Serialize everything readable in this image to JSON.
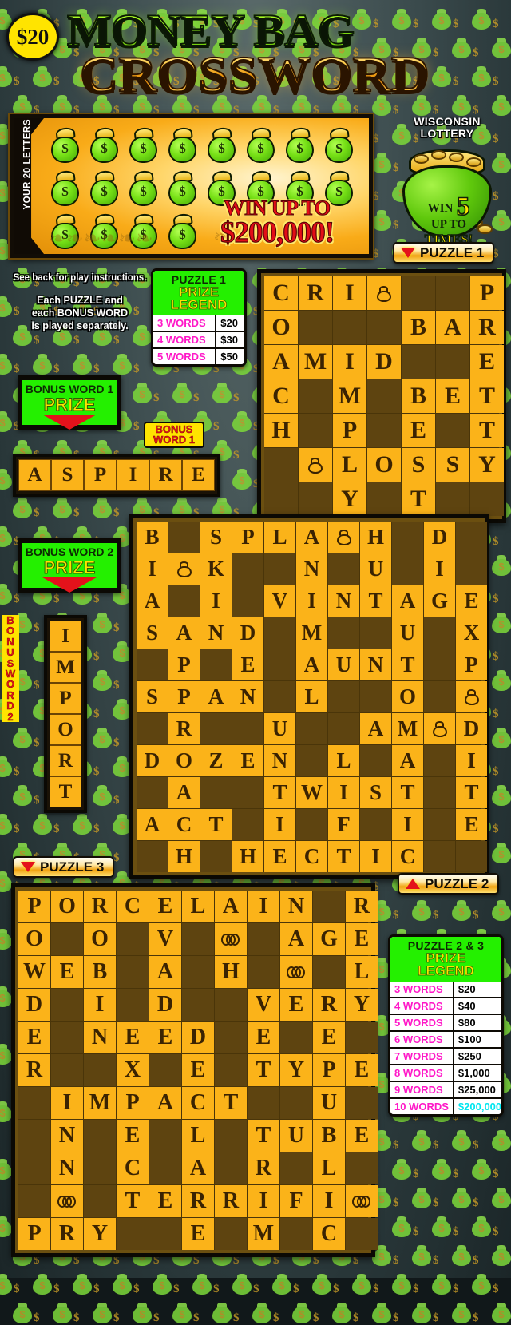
{
  "ticket": {
    "price": "$20",
    "title_line1": "MONEY BAG",
    "title_line2": "CROSSWORD"
  },
  "play_area": {
    "tab_label": "YOUR 20 LETTERS",
    "bag_icon": "money-bag-icon",
    "bag_symbol": "$",
    "bag_rows": [
      8,
      8,
      4
    ],
    "win_up_to_line1": "WIN UP TO",
    "win_up_to_line2": "$200,000!"
  },
  "lottery": {
    "name_line1": "WISCONSIN",
    "name_line2": "LOTTERY",
    "bag_text_a": "WIN",
    "bag_text_b": "UP TO",
    "bag_text_big": "5",
    "bag_text_c": "TIMES!"
  },
  "instructions": {
    "line1": "See back for play instructions.",
    "line2": "Each PUZZLE and",
    "line3": "each BONUS WORD",
    "line4": "is played separately."
  },
  "tabs": {
    "puzzle1": "PUZZLE 1",
    "puzzle2": "PUZZLE 2",
    "puzzle3": "PUZZLE 3"
  },
  "legend_p1": {
    "title": "PUZZLE 1",
    "prize": "PRIZE",
    "legend": "LEGEND",
    "rows": [
      {
        "words": "3 WORDS",
        "prize": "$20"
      },
      {
        "words": "4 WORDS",
        "prize": "$30"
      },
      {
        "words": "5 WORDS",
        "prize": "$50"
      }
    ]
  },
  "legend_p23": {
    "title": "PUZZLE 2 & 3",
    "prize": "PRIZE",
    "legend": "LEGEND",
    "rows": [
      {
        "words": "3 WORDS",
        "prize": "$20"
      },
      {
        "words": "4 WORDS",
        "prize": "$40"
      },
      {
        "words": "5 WORDS",
        "prize": "$80"
      },
      {
        "words": "6 WORDS",
        "prize": "$100"
      },
      {
        "words": "7 WORDS",
        "prize": "$250"
      },
      {
        "words": "8 WORDS",
        "prize": "$1,000"
      },
      {
        "words": "9 WORDS",
        "prize": "$25,000"
      },
      {
        "words": "10 WORDS",
        "prize": "$200,000"
      }
    ],
    "jackpot_color": "#00e6f0"
  },
  "bonus1": {
    "box_title": "BONUS WORD 1",
    "box_prize": "PRIZE",
    "flag_line1": "BONUS",
    "flag_line2": "WORD 1",
    "word": [
      "A",
      "S",
      "P",
      "I",
      "R",
      "E"
    ]
  },
  "bonus2": {
    "box_title": "BONUS WORD 2",
    "box_prize": "PRIZE",
    "flag_text": "BONUS WORD 2",
    "word": [
      "I",
      "M",
      "P",
      "O",
      "R",
      "T"
    ]
  },
  "puzzle1": {
    "cols": 7,
    "rows": 7,
    "cells": [
      [
        "C",
        "R",
        "I",
        "BAG",
        "",
        "",
        "P"
      ],
      [
        "O",
        "",
        "",
        "",
        "B",
        "A",
        "R"
      ],
      [
        "A",
        "M",
        "I",
        "D",
        "",
        "",
        "E"
      ],
      [
        "C",
        "",
        "M",
        "",
        "B",
        "E",
        "T"
      ],
      [
        "H",
        "",
        "P",
        "",
        "E",
        "",
        "T"
      ],
      [
        "",
        "BAG",
        "L",
        "O",
        "S",
        "S",
        "Y"
      ],
      [
        "",
        "",
        "Y",
        "",
        "T",
        "",
        ""
      ]
    ]
  },
  "puzzle2": {
    "cols": 11,
    "rows": 11,
    "cells": [
      [
        "B",
        "",
        "S",
        "P",
        "L",
        "A",
        "BAG",
        "H",
        "",
        "D",
        ""
      ],
      [
        "I",
        "BAG",
        "K",
        "",
        "",
        "N",
        "",
        "U",
        "",
        "I",
        ""
      ],
      [
        "A",
        "",
        "I",
        "",
        "V",
        "I",
        "N",
        "T",
        "A",
        "G",
        "E"
      ],
      [
        "S",
        "A",
        "N",
        "D",
        "",
        "M",
        "",
        "",
        "U",
        "",
        "X"
      ],
      [
        "",
        "P",
        "",
        "E",
        "",
        "A",
        "U",
        "N",
        "T",
        "",
        "P"
      ],
      [
        "S",
        "P",
        "A",
        "N",
        "",
        "L",
        "",
        "",
        "O",
        "",
        "BAG"
      ],
      [
        "",
        "R",
        "",
        "",
        "U",
        "",
        "",
        "A",
        "M",
        "BAG",
        "D"
      ],
      [
        "D",
        "O",
        "Z",
        "E",
        "N",
        "",
        "L",
        "",
        "A",
        "",
        "I"
      ],
      [
        "",
        "A",
        "",
        "",
        "T",
        "W",
        "I",
        "S",
        "T",
        "",
        "T"
      ],
      [
        "A",
        "C",
        "T",
        "",
        "I",
        "",
        "F",
        "",
        "I",
        "",
        "E"
      ],
      [
        "",
        "H",
        "",
        "H",
        "E",
        "C",
        "T",
        "I",
        "C",
        "",
        ""
      ]
    ]
  },
  "puzzle3": {
    "cols": 11,
    "rows": 11,
    "cells": [
      [
        "P",
        "O",
        "R",
        "C",
        "E",
        "L",
        "A",
        "I",
        "N",
        "",
        "R"
      ],
      [
        "O",
        "",
        "O",
        "",
        "V",
        "",
        "COIN",
        "",
        "A",
        "G",
        "E"
      ],
      [
        "W",
        "E",
        "B",
        "",
        "A",
        "",
        "H",
        "",
        "COIN",
        "",
        "L"
      ],
      [
        "D",
        "",
        "I",
        "",
        "D",
        "",
        "",
        "V",
        "E",
        "R",
        "Y"
      ],
      [
        "E",
        "",
        "N",
        "E",
        "E",
        "D",
        "",
        "E",
        "",
        "E",
        ""
      ],
      [
        "R",
        "",
        "",
        "X",
        "",
        "E",
        "",
        "T",
        "Y",
        "P",
        "E"
      ],
      [
        "",
        "I",
        "M",
        "P",
        "A",
        "C",
        "T",
        "",
        "",
        "U",
        ""
      ],
      [
        "",
        "N",
        "",
        "E",
        "",
        "L",
        "",
        "T",
        "U",
        "B",
        "E"
      ],
      [
        "",
        "N",
        "",
        "C",
        "",
        "A",
        "",
        "R",
        "",
        "L",
        ""
      ],
      [
        "",
        "COIN",
        "",
        "T",
        "E",
        "R",
        "R",
        "I",
        "F",
        "I",
        "COIN"
      ],
      [
        "P",
        "R",
        "Y",
        "",
        "",
        "E",
        "",
        "M",
        "",
        "C",
        ""
      ]
    ]
  }
}
